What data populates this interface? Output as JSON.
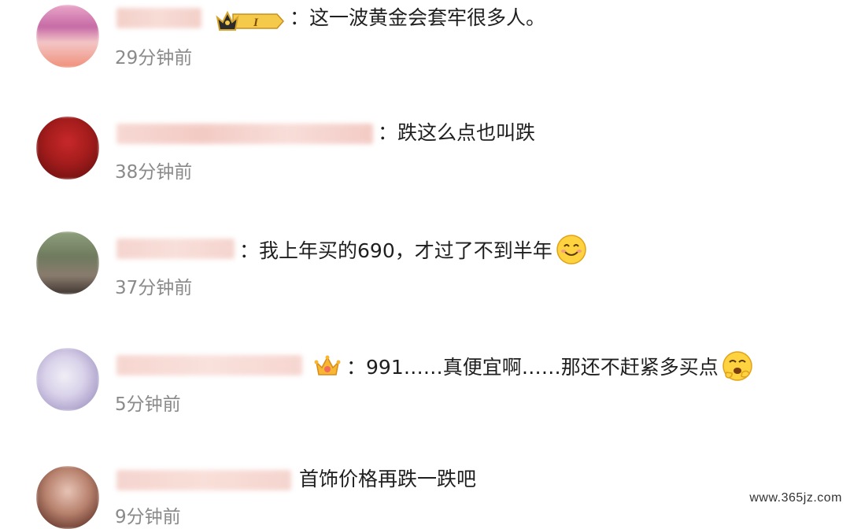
{
  "comments": [
    {
      "separator": "：",
      "text": "这一波黄金会套牢很多人。",
      "time": "29分钟前",
      "badge_label": "I"
    },
    {
      "separator": "：",
      "text": "跌这么点也叫跌",
      "time": "38分钟前"
    },
    {
      "separator": "：",
      "text": "我上年买的690，才过了不到半年",
      "time": "37分钟前"
    },
    {
      "separator": "：",
      "text": "991……真便宜啊……那还不赶紧多买点",
      "time": "5分钟前"
    },
    {
      "separator": "",
      "text": "首饰价格再跌一跌吧",
      "time": "9分钟前"
    }
  ],
  "watermark": "www.365jz.com"
}
